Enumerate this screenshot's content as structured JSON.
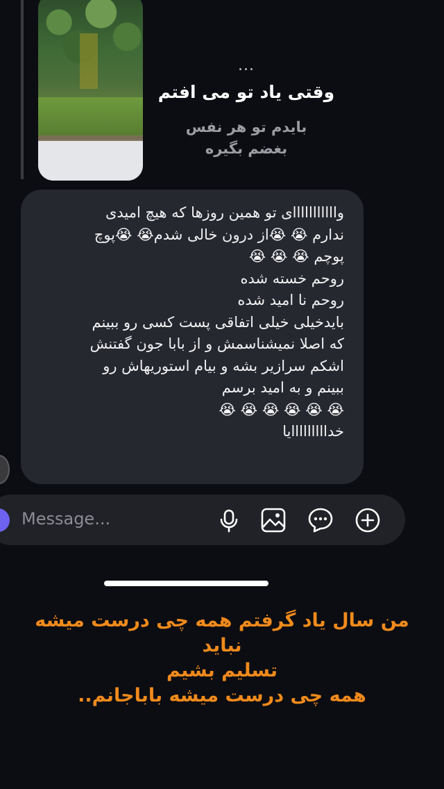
{
  "story_reply": {
    "dots": "...",
    "title": "وقتی یاد تو می افتم",
    "subtitle": "بایدم تو هر نفس\nبغضم بگیره"
  },
  "message": {
    "lines": [
      "وااااااااااای تو همین روزها که هیچ امیدی",
      "ندارم 😭 😭از درون خالی شدم😭 😭پوچ",
      "پوچم 😭 😭 😭",
      "روحم خسته شده",
      "روحم نا امید شده",
      "بایدخیلی خیلی اتفاقی  پست کسی رو ببینم",
      "که اصلا نمیشناسمش و از بابا جون گفتنش",
      "اشکم سرازیر بشه و بیام استوریهاش رو",
      "ببینم و به امید برسم",
      "😭 😭 😭 😭 😭 😭",
      "خدااااااااایا"
    ]
  },
  "composer": {
    "placeholder": "Message..."
  },
  "caption": {
    "lines": [
      "من سال یاد گرفتم همه چی درست میشه نباید",
      "تسلیم بشیم",
      "همه چی درست میشه باباجانم.."
    ]
  },
  "colors": {
    "background": "#0c0d12",
    "bubble": "#26282f",
    "caption": "#f08a1c",
    "accent": "#6e63f0"
  },
  "icons": [
    "microphone-icon",
    "image-icon",
    "sticker-icon",
    "plus-icon"
  ]
}
